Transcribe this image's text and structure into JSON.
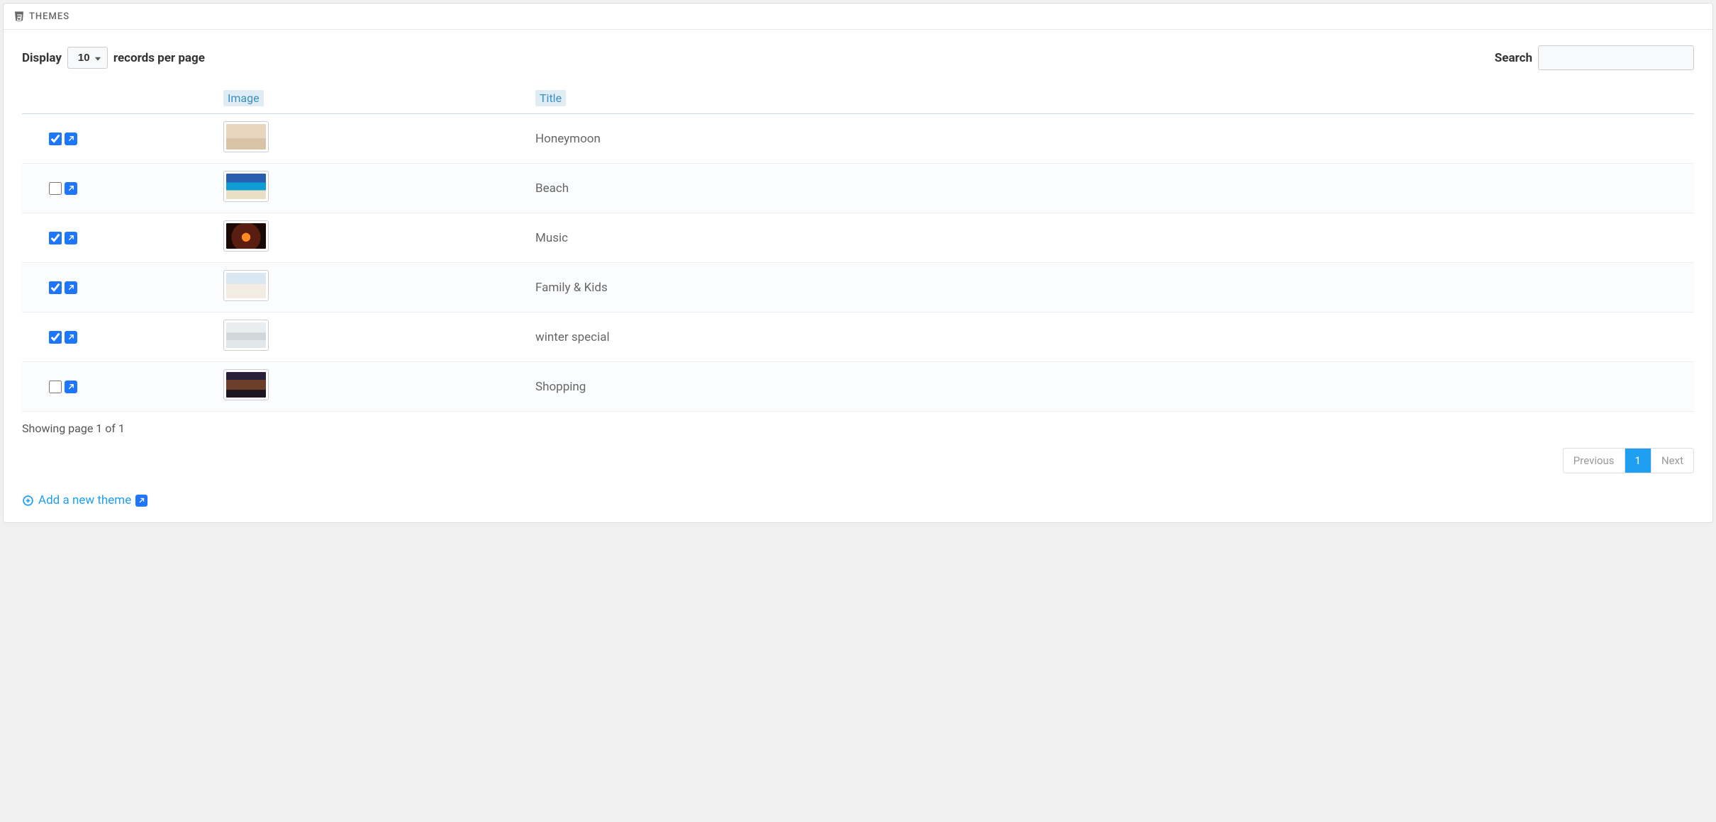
{
  "panel": {
    "title": "THEMES"
  },
  "toolbar": {
    "display_label": "Display",
    "records_suffix": "records per page",
    "page_size": "10",
    "search_label": "Search",
    "search_value": ""
  },
  "table": {
    "headers": {
      "image": "Image",
      "title": "Title"
    },
    "rows": [
      {
        "checked": true,
        "title": "Honeymoon",
        "thumb_bg": "linear-gradient(180deg,#e8d6c0 55%,#d9c3a6 55%)"
      },
      {
        "checked": false,
        "title": "Beach",
        "thumb_bg": "linear-gradient(180deg,#2a5fb0 35%,#0f9dd6 35% 65%,#e9dfc7 65%)"
      },
      {
        "checked": true,
        "title": "Music",
        "thumb_bg": "radial-gradient(circle at 50% 55%,#ff8a1f 0 18%,#5a1e10 18% 60%,#1a0905 60%)"
      },
      {
        "checked": true,
        "title": "Family & Kids",
        "thumb_bg": "linear-gradient(180deg,#d9e8f3 45%,#f2ece3 45%)"
      },
      {
        "checked": true,
        "title": "winter special",
        "thumb_bg": "linear-gradient(180deg,#e9edef 40%,#cfd7da 40% 70%,#e2e7e9 70%)"
      },
      {
        "checked": false,
        "title": "Shopping",
        "thumb_bg": "linear-gradient(180deg,#2a1e3b 30%,#6b3f2a 30% 70%,#1f1520 70%)"
      }
    ]
  },
  "footer": {
    "page_info": "Showing page 1 of 1",
    "prev": "Previous",
    "next": "Next",
    "current_page": "1",
    "add_link": "Add a new theme"
  }
}
